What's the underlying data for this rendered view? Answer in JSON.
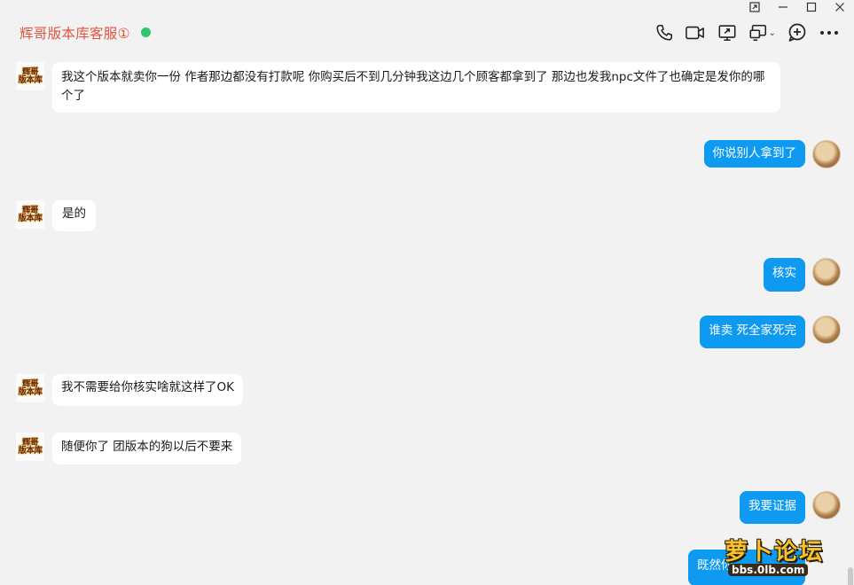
{
  "window": {
    "icons": [
      "pin-icon",
      "minimize-icon",
      "maximize-icon",
      "close-icon"
    ]
  },
  "header": {
    "title": "辉哥版本库客服①",
    "status_color": "#33c56b",
    "tools": [
      "phone-icon",
      "video-icon",
      "screen-share-icon",
      "remote-icon",
      "add-member-icon",
      "more-icon"
    ]
  },
  "avatars": {
    "contact_brand_line1": "辉哥",
    "contact_brand_line2": "版本库"
  },
  "messages": [
    {
      "side": "in",
      "text": "我这个版本就卖你一份 作者那边都没有打款呢 你购买后不到几分钟我这边几个顾客都拿到了 那边也发我npc文件了也确定是发你的哪个了"
    },
    {
      "side": "out",
      "text": "你说别人拿到了"
    },
    {
      "side": "in",
      "text": "是的"
    },
    {
      "side": "out",
      "text": "核实"
    },
    {
      "side": "out",
      "text": "谁卖 死全家死完"
    },
    {
      "side": "in",
      "text": "我不需要给你核实啥就这样了OK"
    },
    {
      "side": "in",
      "text": "随便你了 团版本的狗以后不要来"
    },
    {
      "side": "out",
      "text": "我要证据"
    },
    {
      "side": "out",
      "text": "既然你"
    }
  ],
  "watermark": {
    "main": "萝卜论坛",
    "url": "bbs.0lb.com"
  },
  "colors": {
    "outgoing_bubble": "#0d9af0",
    "incoming_bubble": "#ffffff",
    "title": "#e0533e",
    "background": "#f2f2f2"
  }
}
